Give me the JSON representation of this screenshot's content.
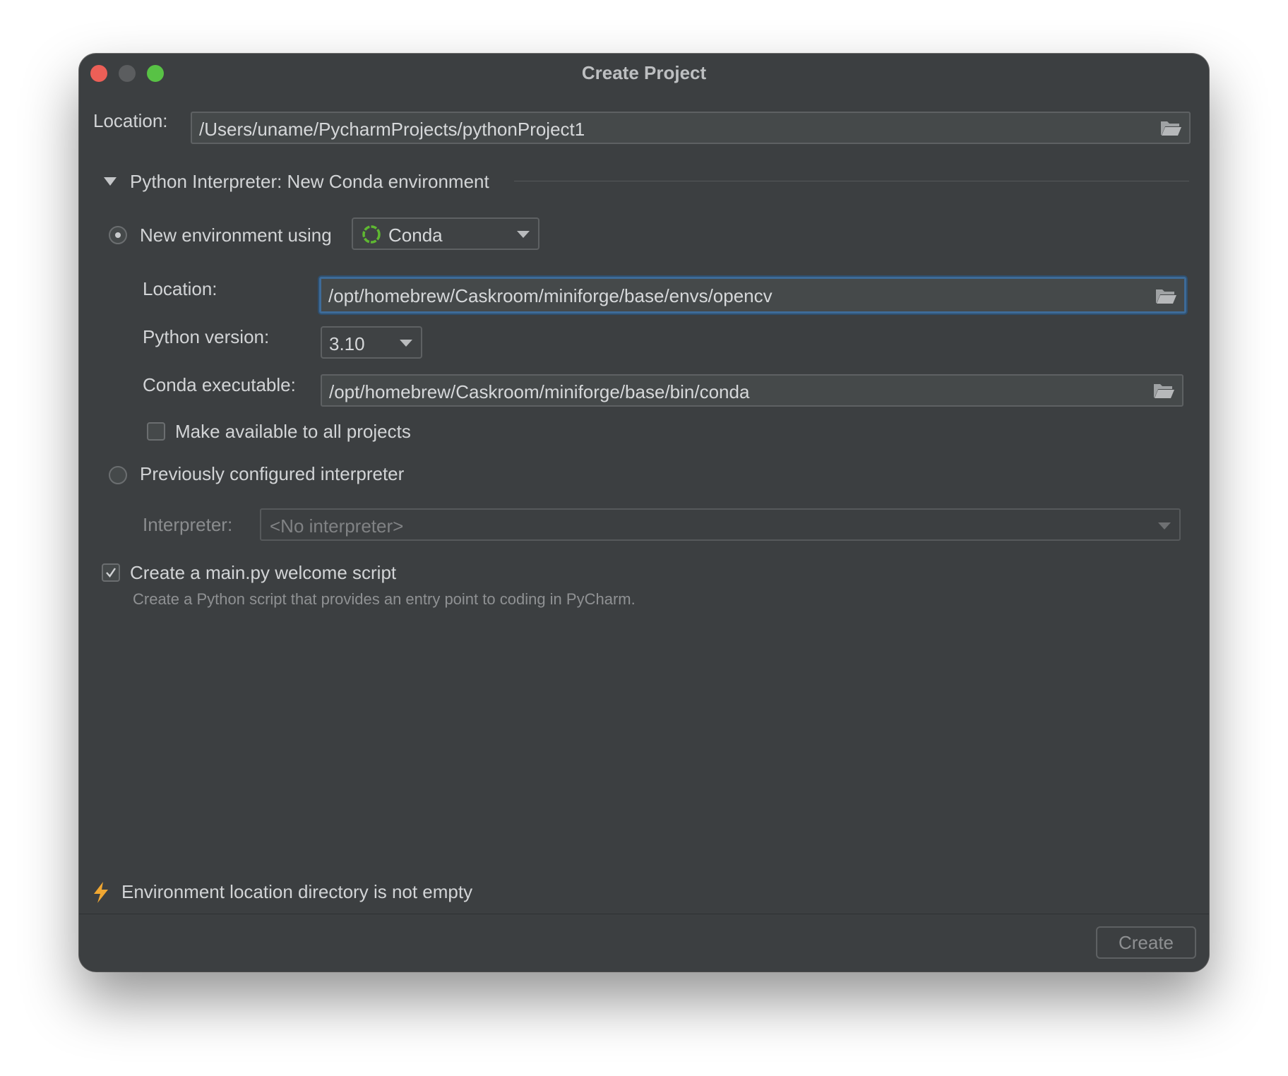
{
  "window": {
    "title": "Create Project"
  },
  "project": {
    "location_label": "Location:",
    "location_value": "/Users/uname/PycharmProjects/pythonProject1"
  },
  "interpreter_section": {
    "header": "Python Interpreter: New Conda environment",
    "new_env": {
      "label": "New environment using",
      "tool": "Conda",
      "location_label": "Location:",
      "location_value": "/opt/homebrew/Caskroom/miniforge/base/envs/opencv",
      "python_version_label": "Python version:",
      "python_version": "3.10",
      "conda_exe_label": "Conda executable:",
      "conda_exe_value": "/opt/homebrew/Caskroom/miniforge/base/bin/conda",
      "make_available_label": "Make available to all projects"
    },
    "previous": {
      "label": "Previously configured interpreter",
      "interpreter_label": "Interpreter:",
      "interpreter_value": "<No interpreter>"
    }
  },
  "welcome_script": {
    "label": "Create a main.py welcome script",
    "description": "Create a Python script that provides an entry point to coding in PyCharm."
  },
  "warning": {
    "text": "Environment location directory is not empty"
  },
  "buttons": {
    "create": "Create"
  },
  "colors": {
    "window_bg": "#3c3f41",
    "focus_border": "#3e6b98",
    "conda_green": "#5fb832",
    "warning_bolt": "#f0a732"
  },
  "icons": [
    "close-icon",
    "minimize-icon",
    "maximize-icon",
    "folder-icon",
    "collapse-triangle-icon",
    "conda-icon",
    "chevron-down-icon",
    "checkmark-icon",
    "lightning-icon"
  ]
}
